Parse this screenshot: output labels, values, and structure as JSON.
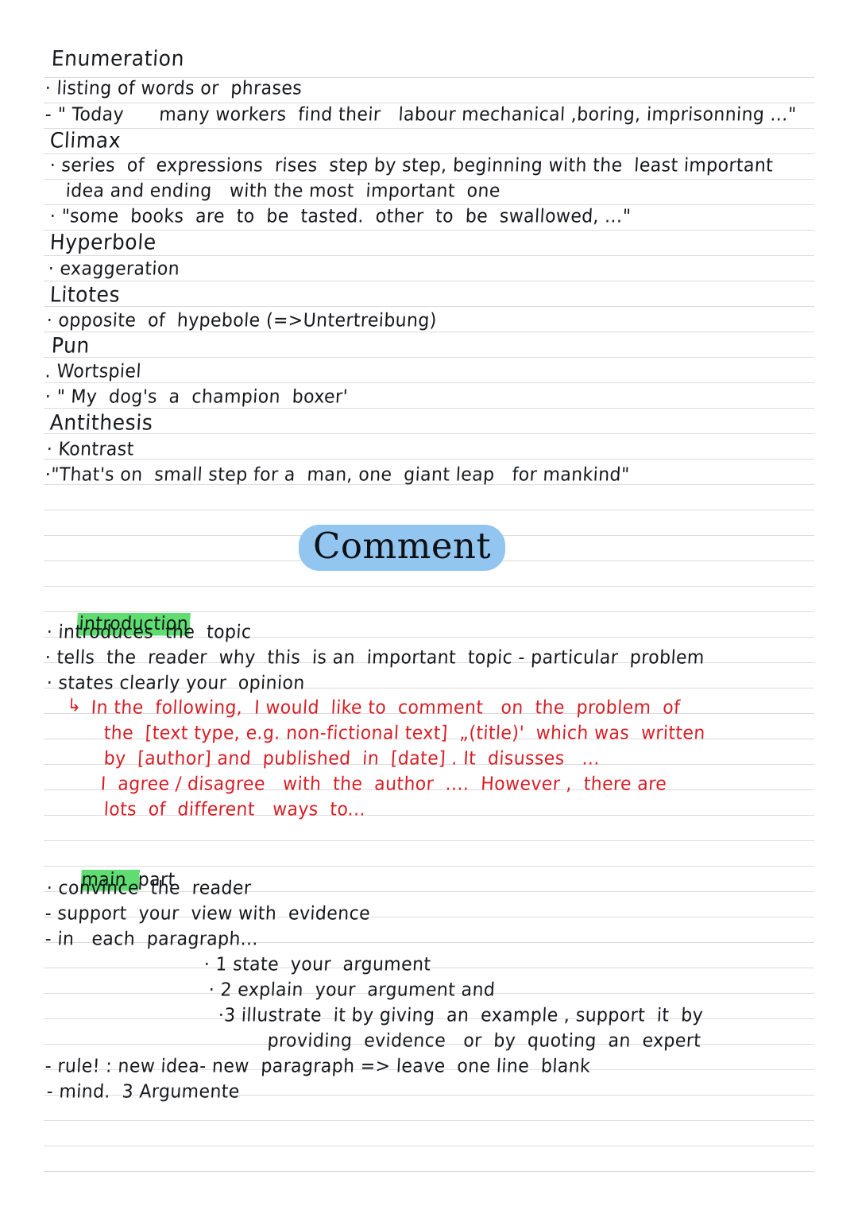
{
  "page": {
    "background_color": "#ffffff",
    "rule_color": "#dcdcdc",
    "ink_black": "#16181c",
    "ink_red": "#d61f26",
    "highlight_green": "#5fdd70",
    "highlight_blue": "#92c5f0"
  },
  "devices": {
    "enumeration": {
      "heading": "Enumeration",
      "lines": [
        "· listing of words or  phrases",
        "- \" Today      many workers  find their   labour mechanical ,boring, imprisonning ...\""
      ]
    },
    "climax": {
      "heading": "Climax",
      "lines": [
        "· series  of  expressions  rises  step by step, beginning with the  least important",
        "idea and ending   with the most  important  one",
        "· \"some  books  are  to  be  tasted.  other  to  be  swallowed, ...\""
      ]
    },
    "hyperbole": {
      "heading": "Hyperbole",
      "lines": [
        "· exaggeration"
      ]
    },
    "litotes": {
      "heading": "Litotes",
      "lines": [
        "· opposite  of  hypebole (=>Untertreibung)"
      ]
    },
    "pun": {
      "heading": "Pun",
      "lines": [
        ". Wortspiel",
        "· \" My  dog's  a  champion  boxer'"
      ]
    },
    "antithesis": {
      "heading": "Antithesis",
      "lines": [
        "· Kontrast",
        "·\"That's on  small step for a  man, one  giant leap   for mankind\""
      ]
    }
  },
  "comment": {
    "title": "Comment",
    "introduction": {
      "heading": "introduction",
      "bullets": [
        "· introduces  the  topic",
        "· tells  the  reader  why  this  is an  important  topic - particular  problem",
        "· states clearly your  opinion"
      ],
      "red_arrow": "↳",
      "red_text": [
        "In the  following,  I would  like to  comment   on  the  problem  of",
        "the  [text type, e.g. non-fictional text]  „(title)'  which was  written",
        "by  [author] and  published  in  [date] . It  disusses   ...",
        "I  agree / disagree   with  the  author  ....  However ,  there are",
        "lots  of  different   ways  to..."
      ]
    },
    "main_part": {
      "heading": "main  part",
      "bullets": [
        "· convince  the  reader",
        "- support  your  view with  evidence",
        "- in   each  paragraph..."
      ],
      "numbered": [
        "· 1 state  your  argument",
        "· 2 explain  your  argument and",
        "·3 illustrate  it by giving  an  example , support  it  by",
        "providing  evidence   or  by  quoting  an  expert"
      ],
      "rules": [
        "- rule! : new idea- new  paragraph => leave  one line  blank",
        "- mind.  3 Argumente"
      ]
    }
  }
}
